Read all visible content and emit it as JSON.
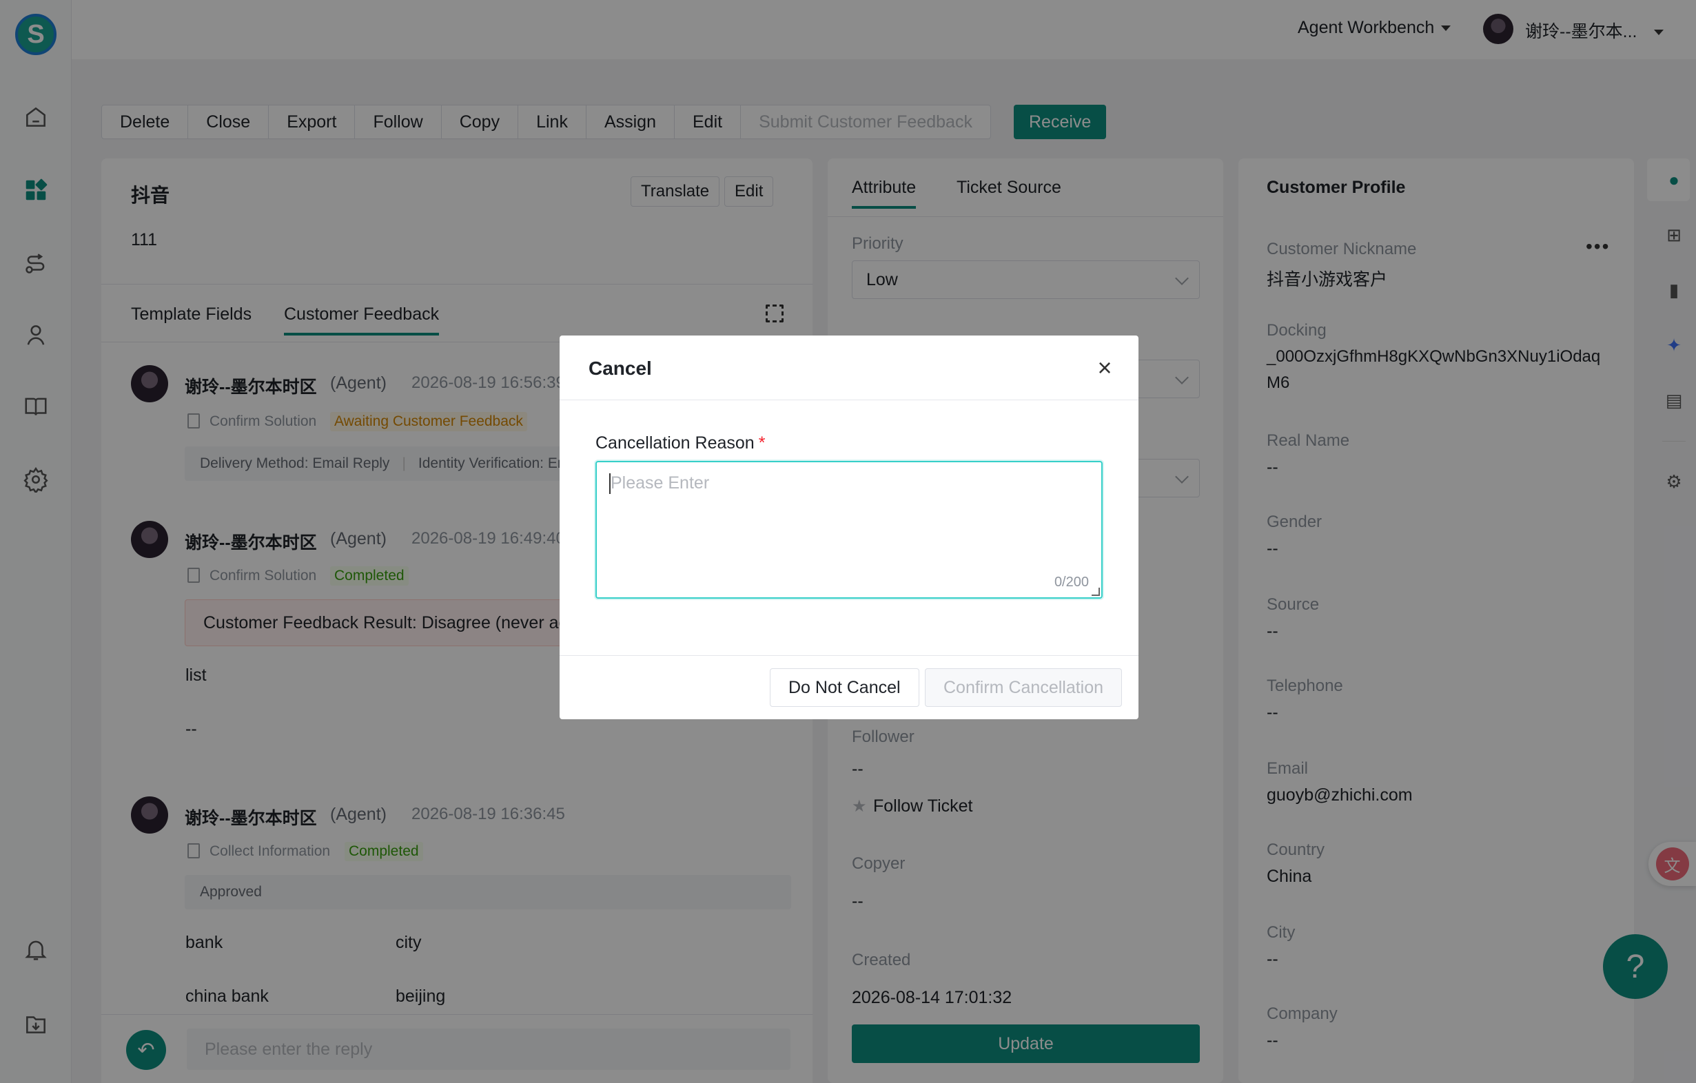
{
  "app": {
    "logo_letter": "S",
    "accent_color": "#0e8f80"
  },
  "top": {
    "workbench_label": "Agent Workbench",
    "user_name": "谢玲--墨尔本..."
  },
  "toolbar": {
    "buttons": [
      "Delete",
      "Close",
      "Export",
      "Follow",
      "Copy",
      "Link",
      "Assign",
      "Edit",
      "Submit Customer Feedback"
    ],
    "receive_label": "Receive"
  },
  "ticket": {
    "title": "抖音",
    "content": "111",
    "translate_label": "Translate",
    "edit_label": "Edit",
    "tabs": [
      "Template Fields",
      "Customer Feedback"
    ],
    "messages": [
      {
        "name": "谢玲--墨尔本时区",
        "role": "(Agent)",
        "time": "2026-08-19 16:56:39",
        "step": "Confirm Solution",
        "status": "Awaiting Customer Feedback",
        "info": "Delivery Method: Email Reply",
        "info2": "Identity Verification: Em"
      },
      {
        "name": "谢玲--墨尔本时区",
        "role": "(Agent)",
        "time": "2026-08-19 16:49:40",
        "step": "Confirm Solution",
        "status": "Completed",
        "result": "Customer Feedback Result: Disagree (never acce",
        "field_label": "list",
        "field_value": "--"
      },
      {
        "name": "谢玲--墨尔本时区",
        "role": "(Agent)",
        "time": "2026-08-19 16:36:45",
        "step": "Collect Information",
        "status": "Completed",
        "approved": "Approved",
        "col1_label": "bank",
        "col2_label": "city",
        "col1_value": "china bank",
        "col2_value": "beijing"
      }
    ],
    "reply_placeholder": "Please enter the reply"
  },
  "attribute": {
    "tabs": [
      "Attribute",
      "Ticket Source"
    ],
    "priority_label": "Priority",
    "priority_value": "Low",
    "follower_label": "Follower",
    "follower_value": "--",
    "follow_ticket_label": "Follow Ticket",
    "copyer_label": "Copyer",
    "copyer_value": "--",
    "created_label": "Created",
    "created_value": "2026-08-14 17:01:32",
    "update_label": "Update"
  },
  "profile": {
    "title": "Customer Profile",
    "fields": [
      {
        "label": "Customer Nickname",
        "value": "抖音小游戏客户"
      },
      {
        "label": "Docking",
        "value": "_000OzxjGfhmH8gKXQwNbGn3XNuy1iOdaq",
        "value2": "M6"
      },
      {
        "label": "Real Name",
        "value": "--"
      },
      {
        "label": "Gender",
        "value": "--"
      },
      {
        "label": "Source",
        "value": "--"
      },
      {
        "label": "Telephone",
        "value": "--"
      },
      {
        "label": "Email",
        "value": "guoyb@zhichi.com"
      },
      {
        "label": "Country",
        "value": "China"
      },
      {
        "label": "City",
        "value": "--"
      },
      {
        "label": "Company",
        "value": "--"
      }
    ]
  },
  "modal": {
    "title": "Cancel",
    "field_label": "Cancellation Reason",
    "required_mark": "*",
    "placeholder": "Please Enter",
    "counter": "0/200",
    "cancel_label": "Do Not Cancel",
    "confirm_label": "Confirm Cancellation"
  }
}
